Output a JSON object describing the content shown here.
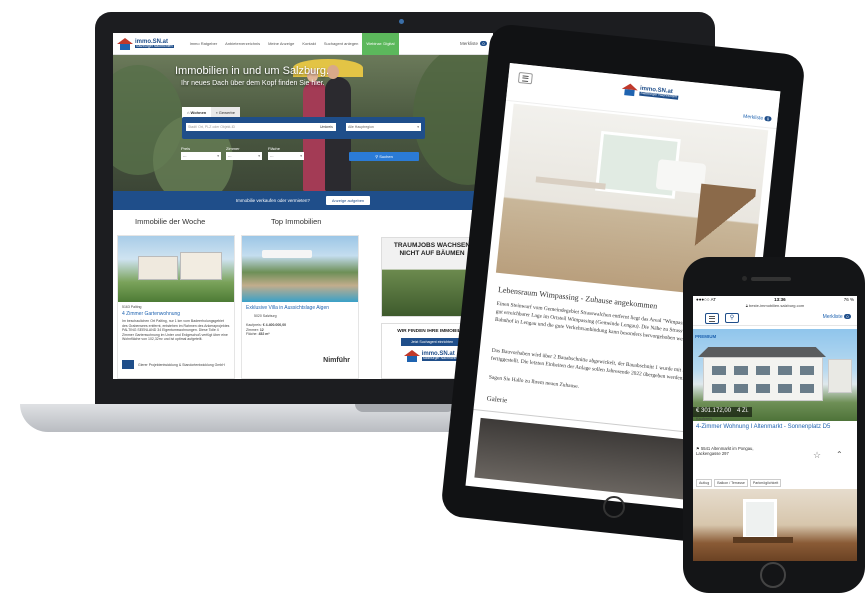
{
  "brand": {
    "logo_main": "immo.SN.at",
    "logo_sub": "Salzburger Nachrichten"
  },
  "laptop": {
    "nav": [
      "Immo Ratgeber",
      "Anbieterverzeichnis",
      "Meine Anzeige",
      "Kontakt",
      "Suchagent anlegen",
      "Webinar: Digital"
    ],
    "merkliste": "Merkliste",
    "merk_count": "0",
    "hero_title": "Immobilien in und um Salzburg.",
    "hero_sub": "Ihr neues Dach über dem Kopf finden Sie hier.",
    "tab_wohnen": "Wohnen",
    "tab_gewerbe": "Gewerbe",
    "search_placeholder": "Stadt/ Ort, PLZ oder Objekt-ID",
    "umkreis": "Umkreis",
    "region": "Alle Hauptregion",
    "preis": "Preis",
    "zimmer": "Zimmer",
    "flaeche": "Fläche",
    "dash": "---",
    "search_btn": "Suchen",
    "strip_text": "Immobilie verkaufen oder vermieten?",
    "strip_btn": "Anzeige aufgeben",
    "woche_h": "Immobilie der Woche",
    "top_h": "Top Immobilien",
    "woche": {
      "plz": "5163 Palting",
      "title": "4 Zimmer Gartenwohnung",
      "desc": "Im beschaulichen Ort Palting, nur 1 km vom Badeerholungsgebiet des Grabensees entfernt, entstehen im Rahmen des Ankeraprojektes PALTING SEENLAND 34 Eigentumswohnungen. Diese Tolle 4 Zimmer Gartenwohnung im Unter und Erdgeschoß verfügt über eine Wohnfläche von 102,32m² und ist optimal aufgeteilt.",
      "agent": "Gierer Projektentwicklung & Standortentwicklung GmbH"
    },
    "top": {
      "title": "Exklusive Villa in Aussichtslage Aigen",
      "place": "5020 Salzburg",
      "kaufpreis_label": "Kaufpreis:",
      "kaufpreis": "€ 4.400.000,00",
      "zimmer_label": "Zimmer:",
      "zimmer": "12",
      "flaeche_label": "Fläche:",
      "flaeche": "452 m²",
      "agent": "Nimführ"
    },
    "ad1": "TRAUMJOBS WACHSEN NICHT AUF BÄUMEN",
    "ad2_title": "WIR FINDEN IHRE IMMOBILIE!",
    "ad2_btn": "Jetzt Suchagent einrichten"
  },
  "tablet": {
    "merkliste": "Merkliste",
    "merk_count": "0",
    "headline": "Lebensraum Wimpassing - Zuhause angekommen",
    "p1": "Einen Steinwurf vom Gemeindegebiet Strasswalchen entfernt liegt das Areal \"Wimpassing\" in leicht erhöhter und gut erreichbarer Lage im Ortsteil Wimpassing (Gemeinde Lengau). Die Nähe zu Strasswalchen (ca. 3 km), zum Bahnhof in Lengau und die gute Verkehrsanbindung kann besonders hervorgehoben werden.",
    "p2": "Das Bauvorhaben wird über 2 Bauabschnitte abgewickelt, der Bauabschnitt 1 wurde mit September 2020 fertiggestellt. Die letzten Einheiten der Anlage sollen Jahresende 2022 übergeben werden.",
    "p3": "Sagen Sie Hallo zu Ihrem neuen Zuhause.",
    "galerie": "Galerie"
  },
  "phone": {
    "carrier": "●●●○○ AT",
    "time": "13:36",
    "battery": "76 %",
    "url": "beste-immobilien.salzburg.com",
    "merkliste": "Merkliste",
    "merk_count": "0",
    "premium": "PREMIUM",
    "price": "€ 301.172,00",
    "rooms": "4 Zi.",
    "price_label": "Kaufpreis",
    "title": "4-Zimmer Wohnung I Altenmarkt - Sonnenplatz D5",
    "address1": "5541 Altenmarkt im Pongau,",
    "address2": "Lackengasse 297",
    "tags": [
      "Autlug",
      "Balkon / Terrasse",
      "Parkmöglichkeit"
    ]
  },
  "colors": {
    "brand_blue": "#1f4e8a",
    "accent_green": "#5cb85c",
    "link_blue": "#1f63b0"
  }
}
